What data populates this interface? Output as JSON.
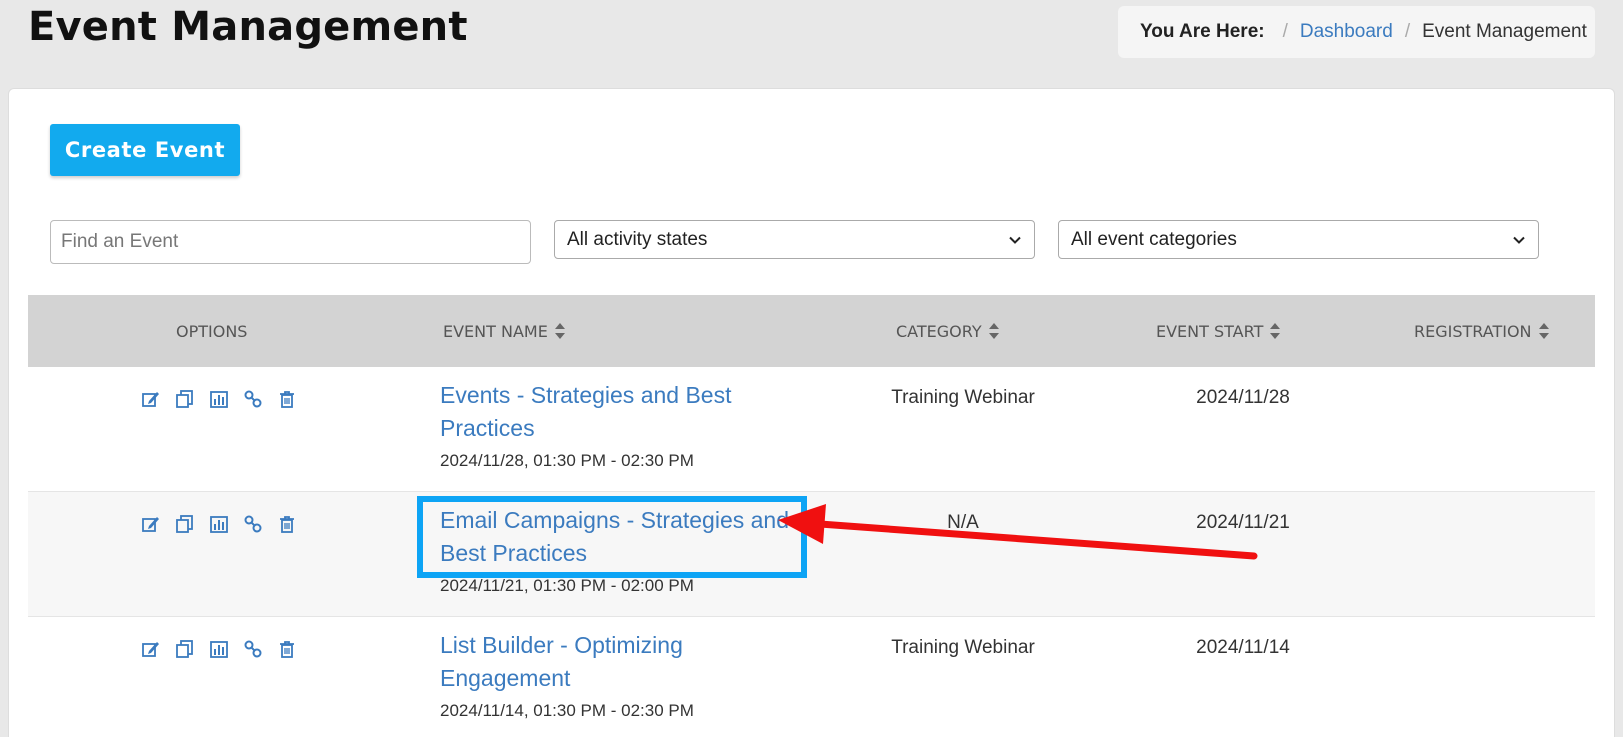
{
  "page": {
    "title": "Event Management"
  },
  "breadcrumb": {
    "label": "You Are Here:",
    "separator": "/",
    "items": [
      "Dashboard",
      "Event Management"
    ]
  },
  "toolbar": {
    "create_label": "Create Event",
    "search_placeholder": "Find an Event",
    "activity_filter": "All activity states",
    "category_filter": "All event categories"
  },
  "table": {
    "headers": {
      "options": "OPTIONS",
      "event_name": "EVENT NAME",
      "category": "CATEGORY",
      "event_start": "EVENT START",
      "registration": "REGISTRATION"
    },
    "rows": [
      {
        "name": "Events - Strategies and Best Practices",
        "time": "2024/11/28, 01:30 PM - 02:30 PM",
        "category": "Training Webinar",
        "start": "2024/11/28",
        "registration": ""
      },
      {
        "name": "Email Campaigns - Strategies and Best Practices",
        "time": "2024/11/21, 01:30 PM - 02:00 PM",
        "category": "N/A",
        "start": "2024/11/21",
        "registration": ""
      },
      {
        "name": "List Builder - Optimizing Engagement",
        "time": "2024/11/14, 01:30 PM - 02:30 PM",
        "category": "Training Webinar",
        "start": "2024/11/14",
        "registration": ""
      }
    ],
    "row_icons": [
      "edit-icon",
      "copy-icon",
      "report-icon",
      "link-icon",
      "trash-icon"
    ]
  },
  "colors": {
    "link": "#3b7bbf",
    "primary_button": "#12aaee",
    "highlight_box": "#0da4f5",
    "annotation_arrow": "#f01010",
    "header_bg": "#d3d3d3"
  }
}
